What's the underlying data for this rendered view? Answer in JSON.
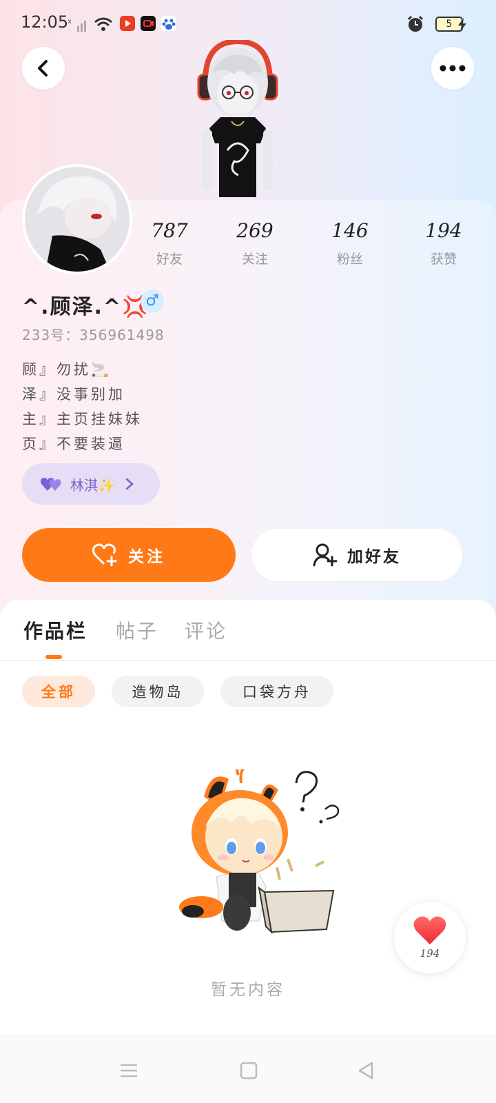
{
  "status_bar": {
    "time": "12:05",
    "battery": "5",
    "icons": [
      "signal-x-icon",
      "wifi-icon",
      "video-app-icon",
      "recorder-app-icon",
      "baidu-app-icon",
      "alarm-icon",
      "battery-icon",
      "charging-icon"
    ]
  },
  "header": {
    "back_icon": "chevron-left-icon",
    "more_icon": "more-dots-icon"
  },
  "stats": [
    {
      "value": "787",
      "label": "好友"
    },
    {
      "value": "269",
      "label": "关注"
    },
    {
      "value": "146",
      "label": "粉丝"
    },
    {
      "value": "194",
      "label": "获赞"
    }
  ],
  "profile": {
    "username": "^.顾泽.^💢",
    "gender_symbol": "♂",
    "uid": "233号：356961498",
    "bio": [
      "顾』勿扰🚬",
      "泽』没事别加",
      "主』主页挂妹妹",
      "页』不要装逼"
    ],
    "intimate_name": "林淇✨"
  },
  "actions": {
    "follow": "关注",
    "add_friend": "加好友"
  },
  "tabs": [
    "作品栏",
    "帖子",
    "评论"
  ],
  "chips": [
    "全部",
    "造物岛",
    "口袋方舟"
  ],
  "empty_text": "暂无内容",
  "like_count": "194",
  "colors": {
    "accent": "#ff7a16",
    "intimate_bg": "#e6ddf6",
    "intimate_text": "#7a61c6",
    "gender_bg": "#d6ecff"
  }
}
